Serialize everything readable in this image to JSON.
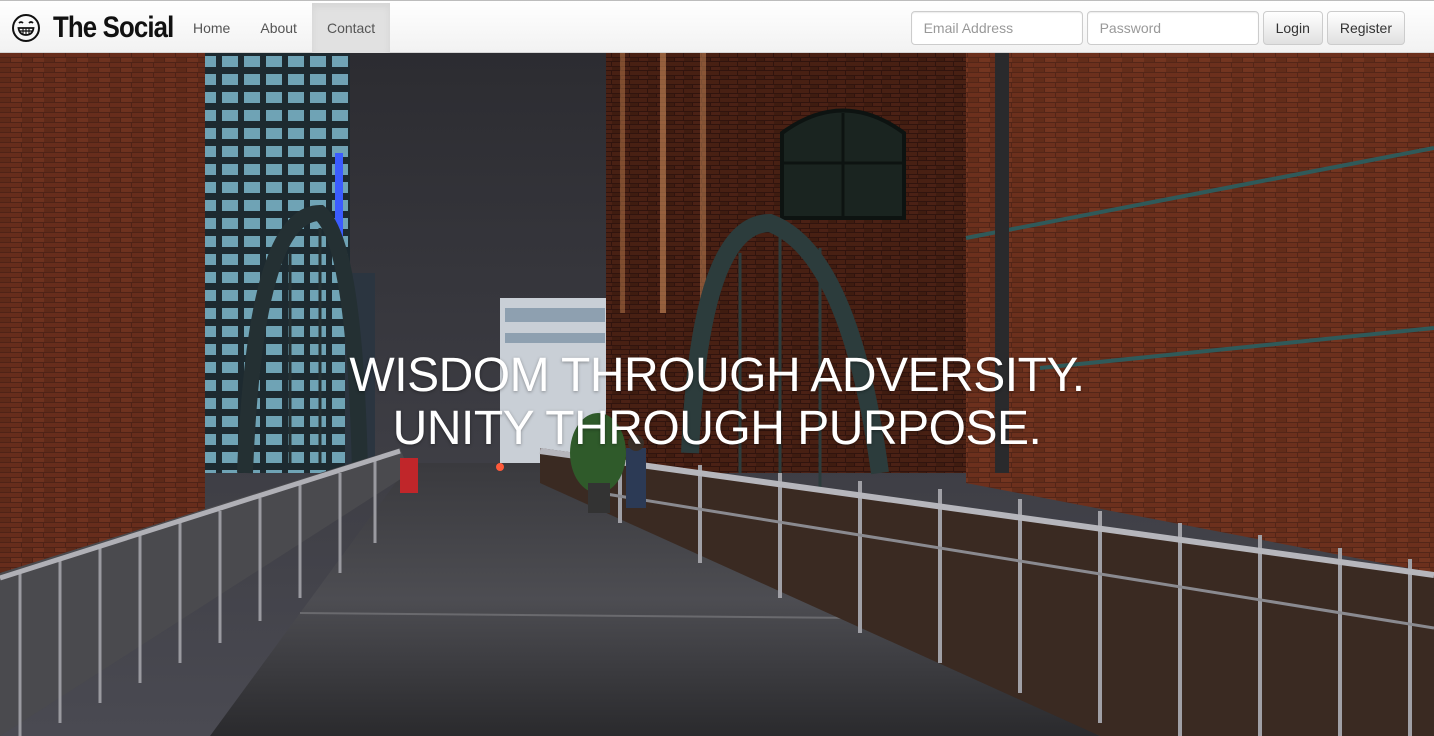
{
  "brand": {
    "name": "The Social",
    "icon": "grinning-face-icon"
  },
  "nav": {
    "items": [
      {
        "label": "Home",
        "active": false
      },
      {
        "label": "About",
        "active": false
      },
      {
        "label": "Contact",
        "active": true
      }
    ]
  },
  "login": {
    "email_placeholder": "Email Address",
    "email_value": "",
    "password_placeholder": "Password",
    "password_value": "",
    "login_label": "Login",
    "register_label": "Register"
  },
  "hero": {
    "line1": "WISDOM THROUGH ADVERSITY.",
    "line2": "UNITY THROUGH PURPOSE."
  },
  "colors": {
    "navbar_bg": "#f8f8f8",
    "active_tab_bg": "#e1e1e1",
    "hero_text": "#ffffff"
  }
}
